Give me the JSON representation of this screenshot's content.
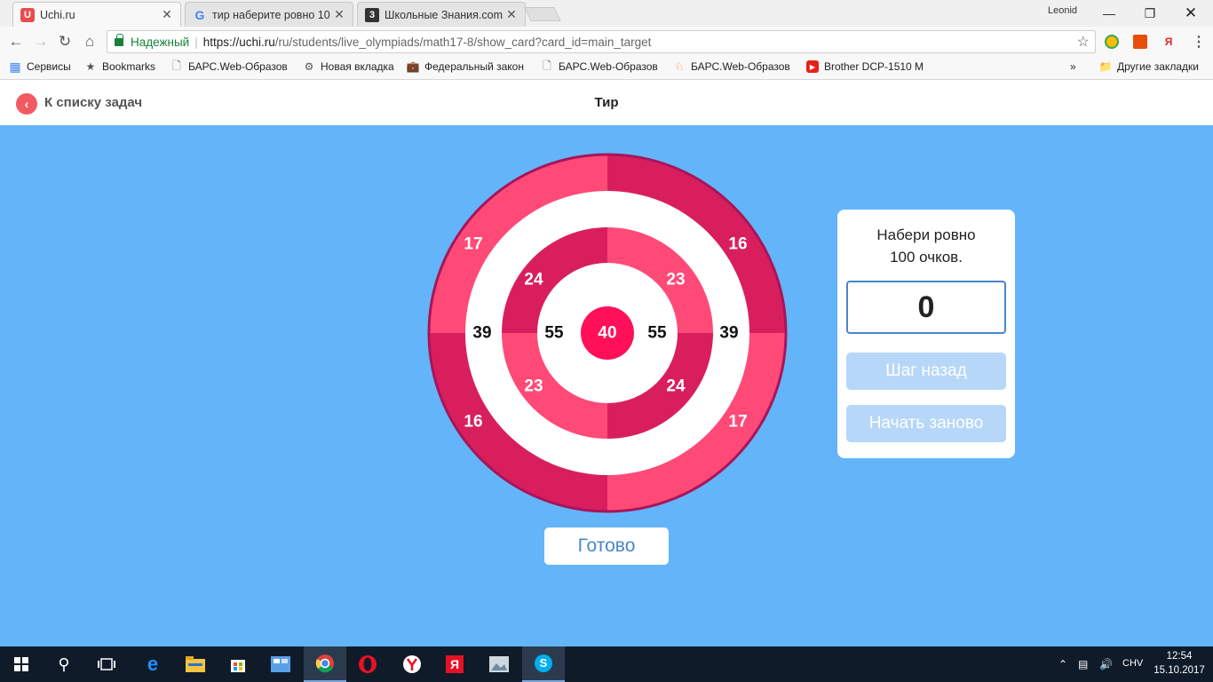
{
  "browser": {
    "tabs": [
      {
        "title": "Uchi.ru",
        "favicon_color": "#e84d4d",
        "favicon_glyph": "U"
      },
      {
        "title": "тир наберите ровно 10",
        "favicon_color": "#4285f4",
        "favicon_glyph": "G"
      },
      {
        "title": "Школьные Знания.com",
        "favicon_color": "#333333",
        "favicon_glyph": "3"
      }
    ],
    "user": "Leonid",
    "address": {
      "secure_label": "Надежный",
      "url_host": "https://uchi.ru",
      "url_path": "/ru/students/live_olympiads/math17-8/show_card?card_id=main_target"
    },
    "bookmarks": [
      {
        "label": "Сервисы",
        "icon": "apps-grid-icon"
      },
      {
        "label": "Bookmarks",
        "icon": "star-icon"
      },
      {
        "label": "БАРС.Web-Образова",
        "icon": "page-icon"
      },
      {
        "label": "Новая вкладка",
        "icon": "gear-icon"
      },
      {
        "label": "Федеральный закон",
        "icon": "briefcase-icon"
      },
      {
        "label": "БАРС.Web-Образова",
        "icon": "page-icon"
      },
      {
        "label": "БАРС.Web-Образова",
        "icon": "horse-icon"
      },
      {
        "label": "Brother DCP-1510 M",
        "icon": "youtube-icon"
      }
    ],
    "bookmarks_more": "»",
    "other_bookmarks": "Другие закладки"
  },
  "page": {
    "back_label": "К списку задач",
    "title": "Тир"
  },
  "target": {
    "outer": [
      "17",
      "16",
      "39",
      "39",
      "16",
      "17"
    ],
    "inner": [
      "24",
      "23",
      "55",
      "55",
      "23",
      "24"
    ],
    "center": "40",
    "colors": {
      "light": "#ff4a78",
      "dark": "#d91e5e",
      "bull": "#ff1058",
      "rim": "#a6165a",
      "white": "#ffffff"
    }
  },
  "panel": {
    "task_line1": "Набери ровно",
    "task_line2": "100 очков.",
    "score": "0",
    "step_back": "Шаг назад",
    "restart": "Начать заново"
  },
  "done_label": "Готово",
  "taskbar": {
    "tray_lang": "CHV",
    "time": "12:54",
    "date": "15.10.2017"
  }
}
